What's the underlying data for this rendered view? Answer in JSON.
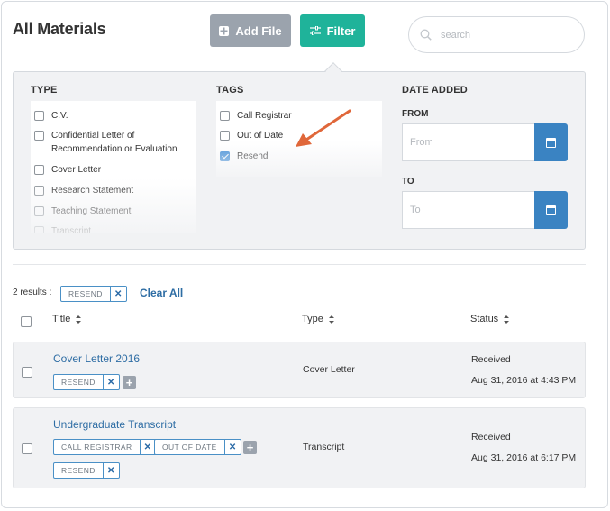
{
  "header": {
    "title": "All Materials",
    "add_file_label": "Add File",
    "filter_label": "Filter",
    "search_placeholder": "search"
  },
  "filter": {
    "type": {
      "heading": "TYPE",
      "items": [
        {
          "label": "C.V.",
          "checked": false
        },
        {
          "label": "Confidential Letter of Recommendation or Evaluation",
          "checked": false
        },
        {
          "label": "Cover Letter",
          "checked": false
        },
        {
          "label": "Research Statement",
          "checked": false
        },
        {
          "label": "Teaching Statement",
          "checked": false
        },
        {
          "label": "Transcript",
          "checked": false
        }
      ]
    },
    "tags": {
      "heading": "TAGS",
      "items": [
        {
          "label": "Call Registrar",
          "checked": false
        },
        {
          "label": "Out of Date",
          "checked": false
        },
        {
          "label": "Resend",
          "checked": true
        }
      ]
    },
    "date": {
      "heading": "DATE ADDED",
      "from_label": "FROM",
      "from_placeholder": "From",
      "to_label": "TO",
      "to_placeholder": "To"
    }
  },
  "results": {
    "count_text": "2 results :",
    "active_tag": "RESEND",
    "clear_all": "Clear All"
  },
  "table": {
    "columns": [
      "Title",
      "Type",
      "Status"
    ],
    "rows": [
      {
        "title": "Cover Letter 2016",
        "type": "Cover Letter",
        "status": "Received",
        "date": "Aug 31, 2016 at 4:43 PM",
        "tags": [
          "RESEND"
        ]
      },
      {
        "title": "Undergraduate Transcript",
        "type": "Transcript",
        "status": "Received",
        "date": "Aug 31, 2016 at 6:17 PM",
        "tags": [
          "CALL REGISTRAR",
          "OUT OF DATE",
          "RESEND"
        ]
      }
    ]
  },
  "colors": {
    "filter_button": "#1fb39a",
    "add_button": "#9ba3ad",
    "link": "#2e6da4",
    "calendar_button": "#3a83c2",
    "annotation_arrow": "#e0673a"
  },
  "icons": {
    "add_file": "plus-square-icon",
    "filter": "sliders-icon",
    "search": "search-icon",
    "calendar": "calendar-icon",
    "sort": "sort-icon",
    "remove": "close-icon",
    "add_tag": "plus-icon"
  }
}
